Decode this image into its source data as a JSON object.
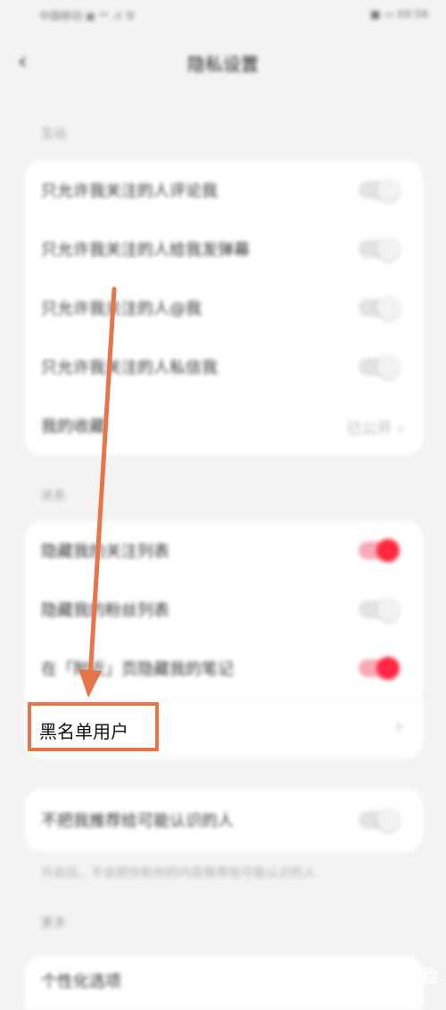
{
  "status_bar": {
    "carrier": "中国移动 ▣ ⁴ᴳ .ıl 令",
    "time": "■ ▭ 09:58"
  },
  "header": {
    "title": "隐私设置",
    "back_icon": "chevron-left-icon"
  },
  "sections": {
    "interaction": {
      "title": "互动",
      "rows": [
        {
          "label": "只允许我关注的人评论我",
          "toggle_on": false
        },
        {
          "label": "只允许我关注的人给我发弹幕",
          "toggle_on": false
        },
        {
          "label": "只允许我关注的人@我",
          "toggle_on": false
        },
        {
          "label": "只允许我关注的人私信我",
          "toggle_on": false
        }
      ],
      "favorites": {
        "label": "我的收藏",
        "value": "已公开",
        "chevron": "›"
      }
    },
    "relations": {
      "title": "关系",
      "rows": [
        {
          "label": "隐藏我的关注列表",
          "toggle_on": true
        },
        {
          "label": "隐藏我的粉丝列表",
          "toggle_on": false
        },
        {
          "label": "在「附近」页隐藏我的笔记",
          "toggle_on": true
        }
      ],
      "blacklist": {
        "label": "黑名单用户",
        "chevron": "›"
      }
    },
    "recommend": {
      "label": "不把我推荐给可能认识的人",
      "toggle_on": false,
      "note": "开启后，不会把你和你的内容推荐给可能认识的人"
    },
    "more": {
      "title": "更多",
      "personalize": "个性化选项"
    }
  },
  "annotation": {
    "color": "#e8744a"
  },
  "watermark": "Bai 经验"
}
